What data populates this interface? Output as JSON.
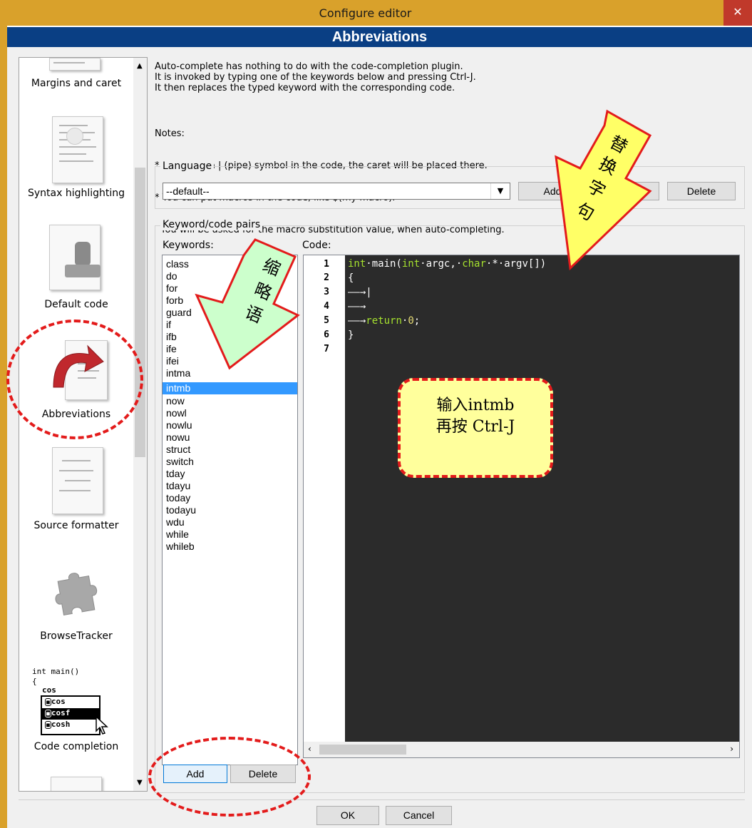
{
  "window": {
    "title": "Configure editor",
    "close_glyph": "✕"
  },
  "banner": "Abbreviations",
  "sidebar": {
    "items": [
      {
        "label": "Margins and caret",
        "icon": "margins-icon"
      },
      {
        "label": "Syntax highlighting",
        "icon": "syntax-highlighting-icon"
      },
      {
        "label": "Default code",
        "icon": "default-code-stamp-icon"
      },
      {
        "label": "Abbreviations",
        "icon": "abbreviations-arrow-icon"
      },
      {
        "label": "Source formatter",
        "icon": "source-formatter-icon"
      },
      {
        "label": "BrowseTracker",
        "icon": "puzzle-piece-icon"
      },
      {
        "label": "Code completion",
        "icon": "code-completion-icon"
      }
    ],
    "code_completion_icon": {
      "line1": "int main()",
      "line2": "{",
      "line3": "cos",
      "options": [
        "cos",
        "cosf",
        "cosh"
      ]
    }
  },
  "description": {
    "lines": [
      "Auto-complete has nothing to do with the code-completion plugin.",
      "It is invoked by typing one of the keywords below and pressing Ctrl-J.",
      "It then replaces the typed keyword with the corresponding code."
    ],
    "notes_lines": [
      "Notes:",
      "* If you put a | (pipe) symbol in the code, the caret will be placed there.",
      "* You can put macros in the code, like $(my macro).",
      "  You will be asked for the macro substitution value, when auto-completing."
    ]
  },
  "language_group": {
    "title": "Language",
    "selected": "--default--",
    "add_label": "Add",
    "copy_label": "Copy",
    "delete_label": "Delete"
  },
  "pairs_group": {
    "title": "Keyword/code pairs",
    "keywords_label": "Keywords:",
    "code_label": "Code:",
    "keywords": [
      "class",
      "do",
      "for",
      "forb",
      "guard",
      "if",
      "ifb",
      "ife",
      "ifei",
      "intma",
      "intmb",
      "now",
      "nowl",
      "nowlu",
      "nowu",
      "struct",
      "switch",
      "tday",
      "tdayu",
      "today",
      "todayu",
      "wdu",
      "while",
      "whileb"
    ],
    "selected_keyword": "intmb",
    "line_numbers": [
      "1",
      "2",
      "3",
      "4",
      "5",
      "6",
      "7"
    ],
    "add_label": "Add",
    "delete_label": "Delete"
  },
  "code": {
    "line1": {
      "kw1": "int",
      "t1": "·main(",
      "kw2": "int",
      "t2": "·argc,·",
      "kw3": "char",
      "t3": "·*·argv[])"
    },
    "line2": "{",
    "line3": "——→|",
    "line4": "——→",
    "line5": {
      "tab": "——→",
      "kw": "return",
      "sp": "·",
      "num": "0",
      "end": ";"
    },
    "line6": "}"
  },
  "footer": {
    "ok_label": "OK",
    "cancel_label": "Cancel"
  },
  "annotations": {
    "replace_text_chars": [
      "替",
      "换",
      "字",
      "句"
    ],
    "abbrev_chars": [
      "缩",
      "略",
      "语"
    ],
    "callout_line1": "输入intmb",
    "callout_line2": "再按 Ctrl-J"
  },
  "colors": {
    "titlebar": "#d9a12b",
    "banner": "#0a3f84",
    "selection": "#3399ff",
    "editor_bg": "#2b2b2b",
    "keyword": "#a6e22e",
    "number": "#e6db74",
    "annotation_red": "#e31b1b",
    "arrow_yellow": "#ffff66",
    "arrow_green": "#ccffcc"
  }
}
